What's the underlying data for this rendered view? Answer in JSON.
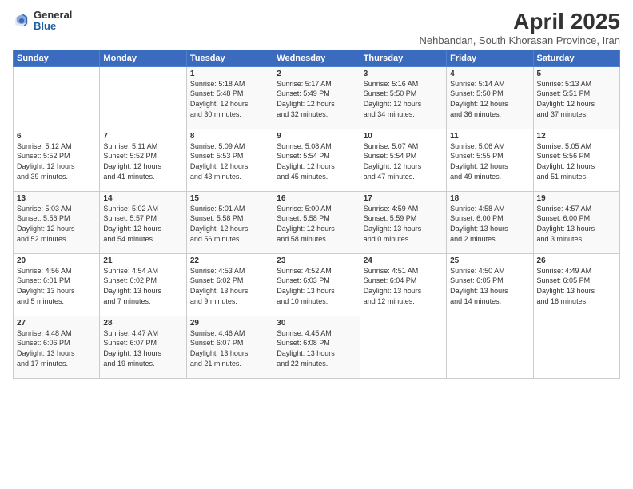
{
  "logo": {
    "general": "General",
    "blue": "Blue"
  },
  "title": "April 2025",
  "subtitle": "Nehbandan, South Khorasan Province, Iran",
  "days_header": [
    "Sunday",
    "Monday",
    "Tuesday",
    "Wednesday",
    "Thursday",
    "Friday",
    "Saturday"
  ],
  "weeks": [
    [
      {
        "day": "",
        "info": ""
      },
      {
        "day": "",
        "info": ""
      },
      {
        "day": "1",
        "info": "Sunrise: 5:18 AM\nSunset: 5:48 PM\nDaylight: 12 hours\nand 30 minutes."
      },
      {
        "day": "2",
        "info": "Sunrise: 5:17 AM\nSunset: 5:49 PM\nDaylight: 12 hours\nand 32 minutes."
      },
      {
        "day": "3",
        "info": "Sunrise: 5:16 AM\nSunset: 5:50 PM\nDaylight: 12 hours\nand 34 minutes."
      },
      {
        "day": "4",
        "info": "Sunrise: 5:14 AM\nSunset: 5:50 PM\nDaylight: 12 hours\nand 36 minutes."
      },
      {
        "day": "5",
        "info": "Sunrise: 5:13 AM\nSunset: 5:51 PM\nDaylight: 12 hours\nand 37 minutes."
      }
    ],
    [
      {
        "day": "6",
        "info": "Sunrise: 5:12 AM\nSunset: 5:52 PM\nDaylight: 12 hours\nand 39 minutes."
      },
      {
        "day": "7",
        "info": "Sunrise: 5:11 AM\nSunset: 5:52 PM\nDaylight: 12 hours\nand 41 minutes."
      },
      {
        "day": "8",
        "info": "Sunrise: 5:09 AM\nSunset: 5:53 PM\nDaylight: 12 hours\nand 43 minutes."
      },
      {
        "day": "9",
        "info": "Sunrise: 5:08 AM\nSunset: 5:54 PM\nDaylight: 12 hours\nand 45 minutes."
      },
      {
        "day": "10",
        "info": "Sunrise: 5:07 AM\nSunset: 5:54 PM\nDaylight: 12 hours\nand 47 minutes."
      },
      {
        "day": "11",
        "info": "Sunrise: 5:06 AM\nSunset: 5:55 PM\nDaylight: 12 hours\nand 49 minutes."
      },
      {
        "day": "12",
        "info": "Sunrise: 5:05 AM\nSunset: 5:56 PM\nDaylight: 12 hours\nand 51 minutes."
      }
    ],
    [
      {
        "day": "13",
        "info": "Sunrise: 5:03 AM\nSunset: 5:56 PM\nDaylight: 12 hours\nand 52 minutes."
      },
      {
        "day": "14",
        "info": "Sunrise: 5:02 AM\nSunset: 5:57 PM\nDaylight: 12 hours\nand 54 minutes."
      },
      {
        "day": "15",
        "info": "Sunrise: 5:01 AM\nSunset: 5:58 PM\nDaylight: 12 hours\nand 56 minutes."
      },
      {
        "day": "16",
        "info": "Sunrise: 5:00 AM\nSunset: 5:58 PM\nDaylight: 12 hours\nand 58 minutes."
      },
      {
        "day": "17",
        "info": "Sunrise: 4:59 AM\nSunset: 5:59 PM\nDaylight: 13 hours\nand 0 minutes."
      },
      {
        "day": "18",
        "info": "Sunrise: 4:58 AM\nSunset: 6:00 PM\nDaylight: 13 hours\nand 2 minutes."
      },
      {
        "day": "19",
        "info": "Sunrise: 4:57 AM\nSunset: 6:00 PM\nDaylight: 13 hours\nand 3 minutes."
      }
    ],
    [
      {
        "day": "20",
        "info": "Sunrise: 4:56 AM\nSunset: 6:01 PM\nDaylight: 13 hours\nand 5 minutes."
      },
      {
        "day": "21",
        "info": "Sunrise: 4:54 AM\nSunset: 6:02 PM\nDaylight: 13 hours\nand 7 minutes."
      },
      {
        "day": "22",
        "info": "Sunrise: 4:53 AM\nSunset: 6:02 PM\nDaylight: 13 hours\nand 9 minutes."
      },
      {
        "day": "23",
        "info": "Sunrise: 4:52 AM\nSunset: 6:03 PM\nDaylight: 13 hours\nand 10 minutes."
      },
      {
        "day": "24",
        "info": "Sunrise: 4:51 AM\nSunset: 6:04 PM\nDaylight: 13 hours\nand 12 minutes."
      },
      {
        "day": "25",
        "info": "Sunrise: 4:50 AM\nSunset: 6:05 PM\nDaylight: 13 hours\nand 14 minutes."
      },
      {
        "day": "26",
        "info": "Sunrise: 4:49 AM\nSunset: 6:05 PM\nDaylight: 13 hours\nand 16 minutes."
      }
    ],
    [
      {
        "day": "27",
        "info": "Sunrise: 4:48 AM\nSunset: 6:06 PM\nDaylight: 13 hours\nand 17 minutes."
      },
      {
        "day": "28",
        "info": "Sunrise: 4:47 AM\nSunset: 6:07 PM\nDaylight: 13 hours\nand 19 minutes."
      },
      {
        "day": "29",
        "info": "Sunrise: 4:46 AM\nSunset: 6:07 PM\nDaylight: 13 hours\nand 21 minutes."
      },
      {
        "day": "30",
        "info": "Sunrise: 4:45 AM\nSunset: 6:08 PM\nDaylight: 13 hours\nand 22 minutes."
      },
      {
        "day": "",
        "info": ""
      },
      {
        "day": "",
        "info": ""
      },
      {
        "day": "",
        "info": ""
      }
    ]
  ]
}
